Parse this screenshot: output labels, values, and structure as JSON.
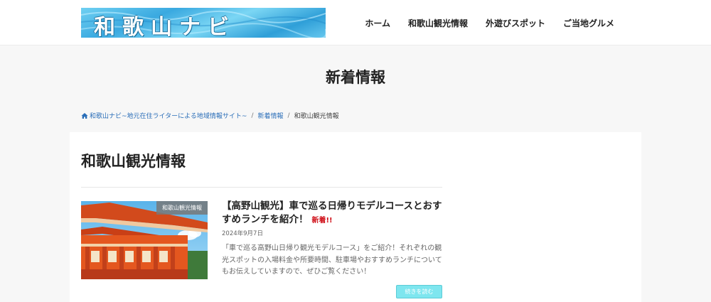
{
  "header": {
    "logo_text": "和歌山ナビ",
    "nav": [
      {
        "label": "ホーム"
      },
      {
        "label": "和歌山観光情報"
      },
      {
        "label": "外遊びスポット"
      },
      {
        "label": "ご当地グルメ"
      }
    ]
  },
  "page": {
    "title": "新着情報"
  },
  "breadcrumb": {
    "home": "和歌山ナビ~地元在住ライターによる地域情報サイト~",
    "category": "新着情報",
    "current": "和歌山観光情報"
  },
  "section": {
    "title": "和歌山観光情報"
  },
  "post": {
    "category_badge": "和歌山観光情報",
    "title": "【高野山観光】車で巡る日帰りモデルコースとおすすめランチを紹介！",
    "new_label": "新着!!",
    "date": "2024年9月7日",
    "excerpt": "「車で巡る高野山日帰り観光モデルコース」をご紹介！それぞれの観光スポットの入場料金や所要時間、駐車場やおすすめランチについてもお伝えしていますので、ぜひご覧ください！",
    "read_more": "続きを読む",
    "image_icon": "pagoda-photo"
  },
  "colors": {
    "accent_link": "#2a6eb8",
    "new_badge": "#d0121b",
    "read_more_bg": "#7ee6ef"
  }
}
